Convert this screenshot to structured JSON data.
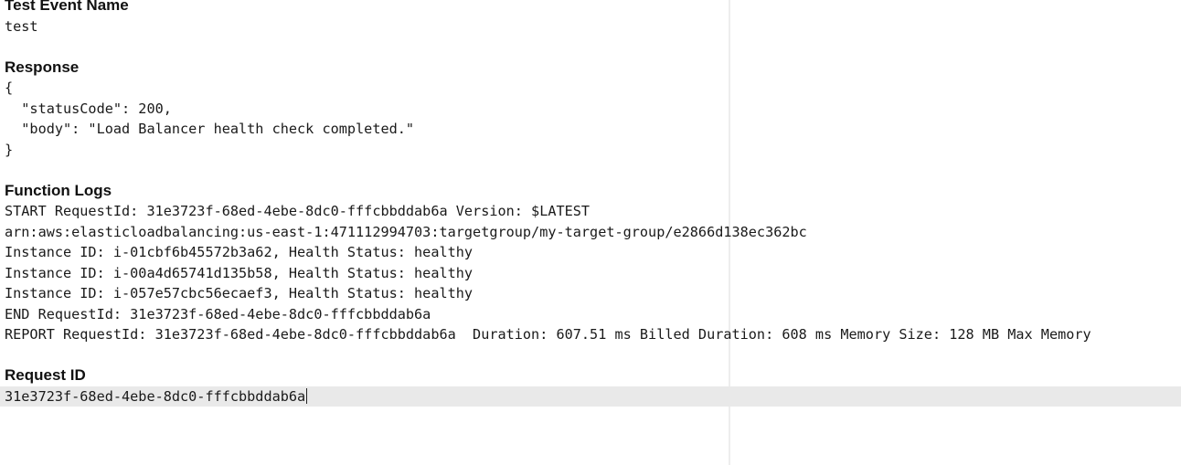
{
  "test_event": {
    "heading": "Test Event Name",
    "value": "test"
  },
  "response": {
    "heading": "Response",
    "lines": [
      "{",
      "  \"statusCode\": 200,",
      "  \"body\": \"Load Balancer health check completed.\"",
      "}"
    ]
  },
  "function_logs": {
    "heading": "Function Logs",
    "lines": [
      "START RequestId: 31e3723f-68ed-4ebe-8dc0-fffcbbddab6a Version: $LATEST",
      "arn:aws:elasticloadbalancing:us-east-1:471112994703:targetgroup/my-target-group/e2866d138ec362bc",
      "Instance ID: i-01cbf6b45572b3a62, Health Status: healthy",
      "Instance ID: i-00a4d65741d135b58, Health Status: healthy",
      "Instance ID: i-057e57cbc56ecaef3, Health Status: healthy",
      "END RequestId: 31e3723f-68ed-4ebe-8dc0-fffcbbddab6a",
      "REPORT RequestId: 31e3723f-68ed-4ebe-8dc0-fffcbbddab6a  Duration: 607.51 ms Billed Duration: 608 ms Memory Size: 128 MB Max Memory"
    ]
  },
  "request_id": {
    "heading": "Request ID",
    "value": "31e3723f-68ed-4ebe-8dc0-fffcbbddab6a"
  }
}
